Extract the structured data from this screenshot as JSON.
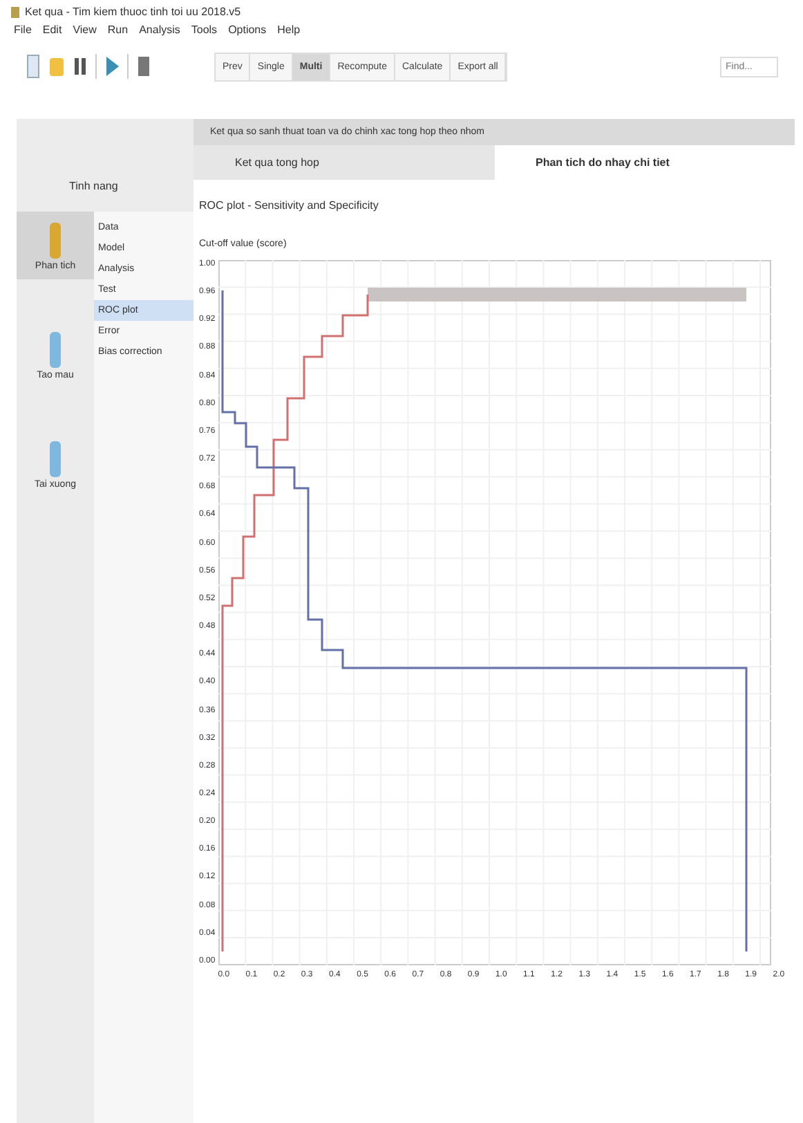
{
  "window": {
    "title": "Ket qua - Tim kiem thuoc tinh toi uu 2018.v5"
  },
  "menu": [
    "File",
    "Edit",
    "View",
    "Run",
    "Analysis",
    "Tools",
    "Options",
    "Help"
  ],
  "toolbar": {
    "modes": [
      {
        "label": "Prev",
        "selected": false
      },
      {
        "label": "Single",
        "selected": false
      },
      {
        "label": "Multi",
        "selected": true
      },
      {
        "label": "Recompute",
        "selected": false
      },
      {
        "label": "Calculate",
        "selected": false
      },
      {
        "label": "Export all",
        "selected": false
      }
    ],
    "search": {
      "placeholder": "Find..."
    }
  },
  "banner": "Ket qua so sanh thuat toan va do chinh xac tong hop theo nhom",
  "sidebar": {
    "title": "Tinh nang",
    "items": [
      {
        "label": "Phan tich",
        "selected": true
      },
      {
        "label": "Tao mau",
        "selected": false
      },
      {
        "label": "Tai xuong",
        "selected": false
      }
    ]
  },
  "list": [
    {
      "label": "Data",
      "selected": false
    },
    {
      "label": "Model",
      "selected": false
    },
    {
      "label": "Analysis",
      "selected": false
    },
    {
      "label": "Test",
      "selected": false
    },
    {
      "label": "ROC plot",
      "selected": true
    },
    {
      "label": "Error",
      "selected": false
    },
    {
      "label": "Bias correction",
      "selected": false
    }
  ],
  "tabs": [
    {
      "label": "Ket qua tong hop",
      "selected": false
    },
    {
      "label": "Phan tich do nhay chi tiet",
      "selected": true
    }
  ],
  "heading": "ROC plot - Sensitivity and Specificity",
  "subheading": "Cut-off value (score)",
  "chart": {
    "yticks": [
      "1.00",
      "0.96",
      "0.92",
      "0.88",
      "0.84",
      "0.80",
      "0.76",
      "0.72",
      "0.68",
      "0.64",
      "0.60",
      "0.56",
      "0.52",
      "0.48",
      "0.44",
      "0.40",
      "0.36",
      "0.32",
      "0.28",
      "0.24",
      "0.20",
      "0.16",
      "0.12",
      "0.08",
      "0.04",
      "0.00"
    ],
    "xticks": [
      "0.0",
      "0.1",
      "0.2",
      "0.3",
      "0.4",
      "0.5",
      "0.6",
      "0.7",
      "0.8",
      "0.9",
      "1.0",
      "1.1",
      "1.2",
      "1.3",
      "1.4",
      "1.5",
      "1.6",
      "1.7",
      "1.8",
      "1.9",
      "2.0"
    ]
  }
}
